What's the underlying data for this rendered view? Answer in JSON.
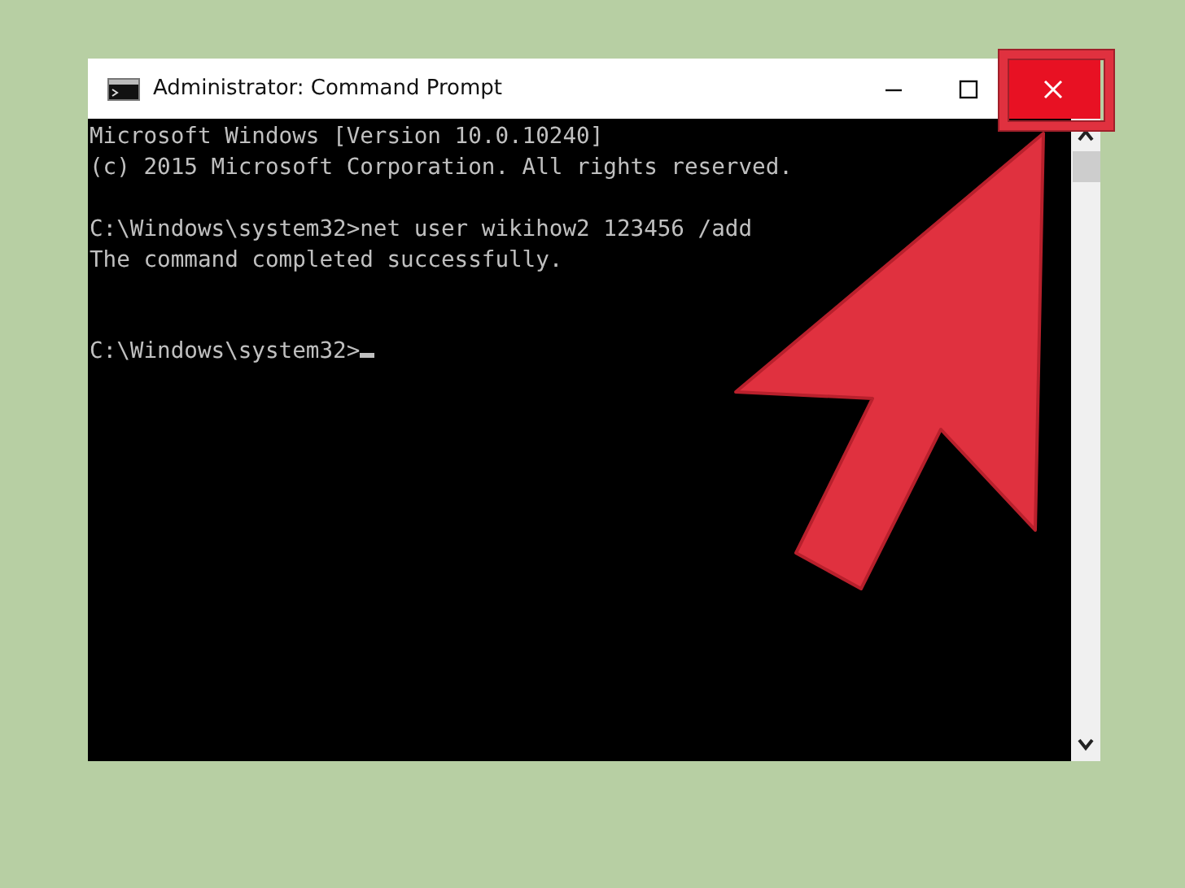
{
  "window": {
    "title": "Administrator: Command Prompt",
    "close_highlighted": true
  },
  "console": {
    "lines": [
      {
        "kind": "text",
        "text": "Microsoft Windows [Version 10.0.10240]"
      },
      {
        "kind": "text",
        "text": "(c) 2015 Microsoft Corporation. All rights reserved."
      },
      {
        "kind": "blank"
      },
      {
        "kind": "text",
        "text": "C:\\Windows\\system32>net user wikihow2 123456 /add"
      },
      {
        "kind": "text",
        "text": "The command completed successfully."
      },
      {
        "kind": "blank"
      },
      {
        "kind": "blank"
      },
      {
        "kind": "prompt",
        "text": "C:\\Windows\\system32>",
        "cursor": true
      }
    ]
  }
}
